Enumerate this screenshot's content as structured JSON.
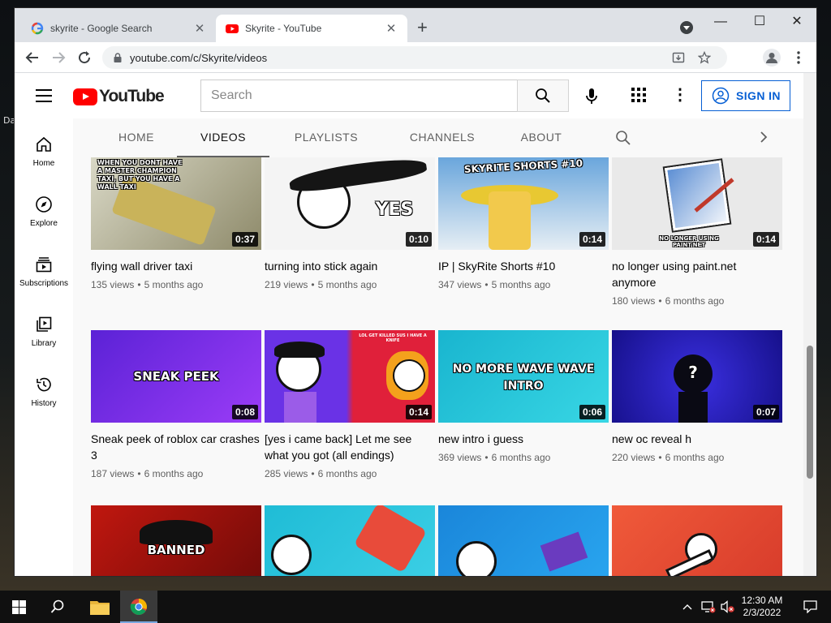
{
  "browser": {
    "tabs": [
      {
        "title": "skyrite - Google Search",
        "favicon": "google-g-icon",
        "active": false
      },
      {
        "title": "Skyrite - YouTube",
        "favicon": "youtube-icon",
        "active": true
      }
    ],
    "address": "youtube.com/c/Skyrite/videos",
    "window_controls": {
      "minimize": "—",
      "maximize": "☐",
      "close": "✕"
    }
  },
  "youtube": {
    "logo_text": "YouTube",
    "search_placeholder": "Search",
    "sign_in_label": "SIGN IN",
    "guide": [
      {
        "label": "Home",
        "icon": "home-icon"
      },
      {
        "label": "Explore",
        "icon": "compass-icon"
      },
      {
        "label": "Subscriptions",
        "icon": "subscriptions-icon"
      },
      {
        "label": "Library",
        "icon": "library-icon"
      },
      {
        "label": "History",
        "icon": "history-icon"
      }
    ],
    "channel_tabs": [
      "HOME",
      "VIDEOS",
      "PLAYLISTS",
      "CHANNELS",
      "ABOUT"
    ],
    "selected_tab": "VIDEOS",
    "videos": [
      {
        "title": "flying wall driver taxi",
        "views": "135 views",
        "age": "5 months ago",
        "duration": "0:37",
        "thumb_text": "WHEN YOU DONT HAVE A MASTER CHAMPION TAXI, BUT YOU HAVE A WALL TAXI",
        "bg": "#b9b7a0"
      },
      {
        "title": "turning into stick again",
        "views": "219 views",
        "age": "5 months ago",
        "duration": "0:10",
        "thumb_text": "YES",
        "bg": "#f4f4f4"
      },
      {
        "title": "IP | SkyRite Shorts #10",
        "views": "347 views",
        "age": "5 months ago",
        "duration": "0:14",
        "thumb_text": "SKYRITE SHORTS #10",
        "bg": "#5a95c8"
      },
      {
        "title": "no longer using paint.net anymore",
        "views": "180 views",
        "age": "6 months ago",
        "duration": "0:14",
        "thumb_text": "NO LONGER USING PAINT.NET",
        "bg": "#e6e6e6"
      },
      {
        "title": "Sneak peek of roblox car crashes 3",
        "views": "187 views",
        "age": "6 months ago",
        "duration": "0:08",
        "thumb_text": "SNEAK PEEK",
        "bg": "#7b2ff0"
      },
      {
        "title": "[yes i came back] Let me see what you got (all endings)",
        "views": "285 views",
        "age": "6 months ago",
        "duration": "0:14",
        "thumb_text": "LOL GET KILLED SUS I HAVE A KNIFE",
        "bg": "#6a32e6"
      },
      {
        "title": "new intro i guess",
        "views": "369 views",
        "age": "6 months ago",
        "duration": "0:06",
        "thumb_text": "NO MORE WAVE WAVE INTRO",
        "bg": "#21c7d8"
      },
      {
        "title": "new oc reveal h",
        "views": "220 views",
        "age": "6 months ago",
        "duration": "0:07",
        "thumb_text": "?",
        "bg": "#2a1fb5"
      },
      {
        "title": "",
        "views": "",
        "age": "",
        "duration": "",
        "thumb_text": "BANNED",
        "bg": "#b3120f"
      },
      {
        "title": "",
        "views": "",
        "age": "",
        "duration": "",
        "thumb_text": "",
        "bg": "#2ab8d8"
      },
      {
        "title": "",
        "views": "",
        "age": "",
        "duration": "",
        "thumb_text": "",
        "bg": "#1e8fe0"
      },
      {
        "title": "",
        "views": "",
        "age": "",
        "duration": "",
        "thumb_text": "",
        "bg": "#e84a3a"
      }
    ]
  },
  "taskbar": {
    "time": "12:30 AM",
    "date": "2/3/2022"
  },
  "desktop_fragments": [
    "Da"
  ]
}
